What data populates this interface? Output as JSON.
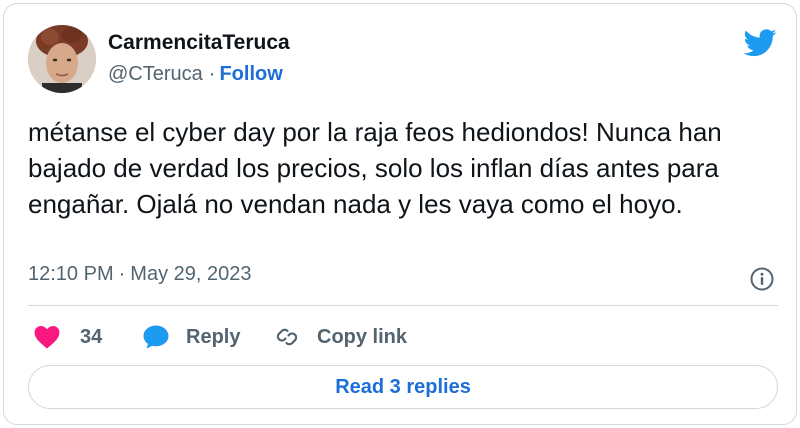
{
  "author": {
    "display_name": "CarmencitaTeruca",
    "handle": "@CTeruca",
    "separator": "·",
    "follow_label": "Follow"
  },
  "tweet": {
    "text": "métanse el cyber day por la raja feos hediondos! Nunca han bajado de verdad los precios, solo los inflan días antes para engañar. Ojalá no vendan nada y les vaya como el hoyo.",
    "time": "12:10 PM",
    "separator": "·",
    "date": "May 29, 2023"
  },
  "actions": {
    "like_count": "34",
    "reply_label": "Reply",
    "copy_link_label": "Copy link"
  },
  "footer": {
    "read_replies_label": "Read 3 replies"
  },
  "icons": {
    "brand": "twitter-bird-icon",
    "info": "info-icon",
    "like": "heart-icon",
    "reply": "speech-bubble-icon",
    "copy": "link-icon"
  },
  "colors": {
    "brand_blue": "#1d9bf0",
    "link_blue": "#1d6ed8",
    "like_pink": "#f91880",
    "muted_text": "#536471",
    "border": "#cfd9de"
  }
}
